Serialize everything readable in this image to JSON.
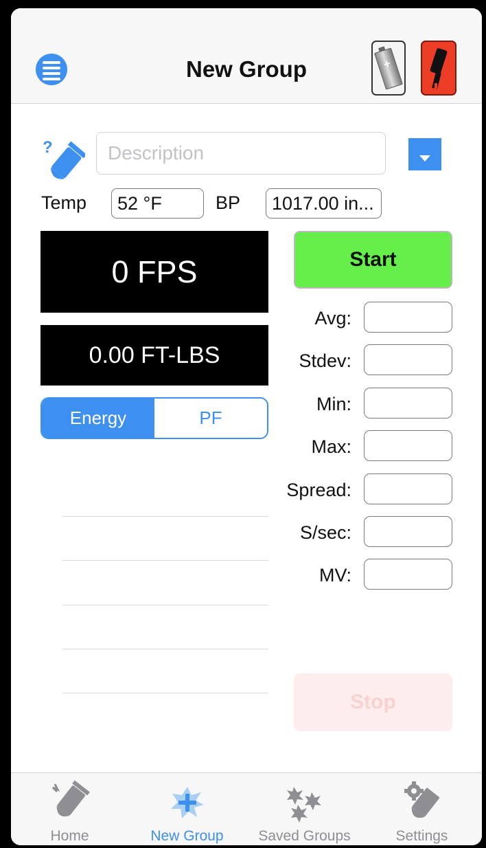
{
  "header": {
    "title": "New Group"
  },
  "description": {
    "placeholder": "Description",
    "value": ""
  },
  "conditions": {
    "temp_label": "Temp",
    "temp_value": "52 °F",
    "bp_label": "BP",
    "bp_value": "1017.00 in..."
  },
  "display": {
    "velocity": "0 FPS",
    "energy": "0.00 FT-LBS"
  },
  "segment": {
    "energy_label": "Energy",
    "pf_label": "PF",
    "selected": "Energy"
  },
  "buttons": {
    "start": "Start",
    "stop": "Stop"
  },
  "stats": {
    "avg": "Avg:",
    "stdev": "Stdev:",
    "min": "Min:",
    "max": "Max:",
    "spread": "Spread:",
    "ssec": "S/sec:",
    "mv": "MV:"
  },
  "tabs": [
    {
      "label": "Home",
      "icon": "bullet-icon"
    },
    {
      "label": "New Group",
      "icon": "add-group-icon"
    },
    {
      "label": "Saved Groups",
      "icon": "saved-groups-icon"
    },
    {
      "label": "Settings",
      "icon": "settings-bullet-icon"
    }
  ],
  "colors": {
    "accent": "#3d8ff0",
    "start": "#66ee4a",
    "stop_disabled": "#fdeeed",
    "chrono": "#ee3d27"
  }
}
